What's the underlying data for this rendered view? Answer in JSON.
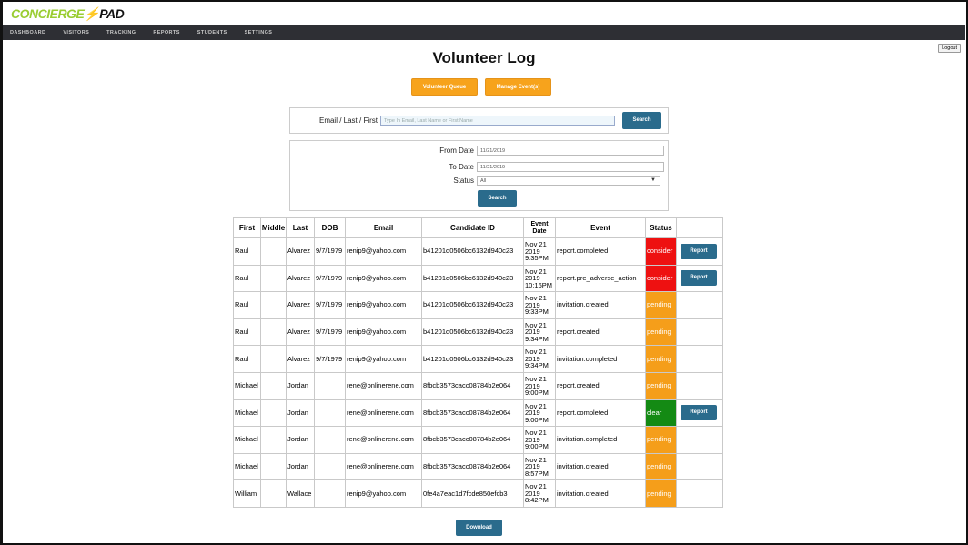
{
  "app": {
    "logo_part1": "CONCIERGE",
    "logo_bolt": "⚡",
    "logo_part2": "PAD"
  },
  "nav": {
    "items": [
      "DASHBOARD",
      "VISITORS",
      "TRACKING",
      "REPORTS",
      "STUDENTS",
      "SETTINGS"
    ]
  },
  "header": {
    "logout_label": "Logout",
    "title": "Volunteer Log"
  },
  "actions": {
    "volunteer_queue": "Volunteer Queue",
    "manage_events": "Manage Event(s)"
  },
  "search": {
    "label": "Email / Last / First",
    "placeholder": "Type In Email, Last Name or First Name",
    "button": "Search"
  },
  "filter": {
    "from_label": "From Date",
    "from_value": "11/21/2019",
    "to_label": "To Date",
    "to_value": "11/21/2019",
    "status_label": "Status",
    "status_value": "All",
    "button": "Search"
  },
  "table": {
    "headers": [
      "First",
      "Middle",
      "Last",
      "DOB",
      "Email",
      "Candidate ID",
      "Event Date",
      "Event",
      "Status",
      ""
    ],
    "rows": [
      {
        "first": "Raul",
        "middle": "",
        "last": "Alvarez",
        "dob": "9/7/1979",
        "email": "renip9@yahoo.com",
        "cid": "b41201d0506bc6132d940c23",
        "date": "Nov 21 2019 9:35PM",
        "event": "report.completed",
        "status": "consider",
        "action": "Report"
      },
      {
        "first": "Raul",
        "middle": "",
        "last": "Alvarez",
        "dob": "9/7/1979",
        "email": "renip9@yahoo.com",
        "cid": "b41201d0506bc6132d940c23",
        "date": "Nov 21 2019 10:16PM",
        "event": "report.pre_adverse_action",
        "status": "consider",
        "action": "Report"
      },
      {
        "first": "Raul",
        "middle": "",
        "last": "Alvarez",
        "dob": "9/7/1979",
        "email": "renip9@yahoo.com",
        "cid": "b41201d0506bc6132d940c23",
        "date": "Nov 21 2019 9:33PM",
        "event": "invitation.created",
        "status": "pending",
        "action": ""
      },
      {
        "first": "Raul",
        "middle": "",
        "last": "Alvarez",
        "dob": "9/7/1979",
        "email": "renip9@yahoo.com",
        "cid": "b41201d0506bc6132d940c23",
        "date": "Nov 21 2019 9:34PM",
        "event": "report.created",
        "status": "pending",
        "action": ""
      },
      {
        "first": "Raul",
        "middle": "",
        "last": "Alvarez",
        "dob": "9/7/1979",
        "email": "renip9@yahoo.com",
        "cid": "b41201d0506bc6132d940c23",
        "date": "Nov 21 2019 9:34PM",
        "event": "invitation.completed",
        "status": "pending",
        "action": ""
      },
      {
        "first": "Michael",
        "middle": "",
        "last": "Jordan",
        "dob": "",
        "email": "rene@onlinerene.com",
        "cid": "8fbcb3573cacc08784b2e064",
        "date": "Nov 21 2019 9:00PM",
        "event": "report.created",
        "status": "pending",
        "action": ""
      },
      {
        "first": "Michael",
        "middle": "",
        "last": "Jordan",
        "dob": "",
        "email": "rene@onlinerene.com",
        "cid": "8fbcb3573cacc08784b2e064",
        "date": "Nov 21 2019 9:00PM",
        "event": "report.completed",
        "status": "clear",
        "action": "Report"
      },
      {
        "first": "Michael",
        "middle": "",
        "last": "Jordan",
        "dob": "",
        "email": "rene@onlinerene.com",
        "cid": "8fbcb3573cacc08784b2e064",
        "date": "Nov 21 2019 9:00PM",
        "event": "invitation.completed",
        "status": "pending",
        "action": ""
      },
      {
        "first": "Michael",
        "middle": "",
        "last": "Jordan",
        "dob": "",
        "email": "rene@onlinerene.com",
        "cid": "8fbcb3573cacc08784b2e064",
        "date": "Nov 21 2019 8:57PM",
        "event": "invitation.created",
        "status": "pending",
        "action": ""
      },
      {
        "first": "William",
        "middle": "",
        "last": "Wallace",
        "dob": "",
        "email": "renip9@yahoo.com",
        "cid": "0fe4a7eac1d7fcde850efcb3",
        "date": "Nov 21 2019 8:42PM",
        "event": "invitation.created",
        "status": "pending",
        "action": ""
      }
    ]
  },
  "footer": {
    "download_label": "Download"
  }
}
